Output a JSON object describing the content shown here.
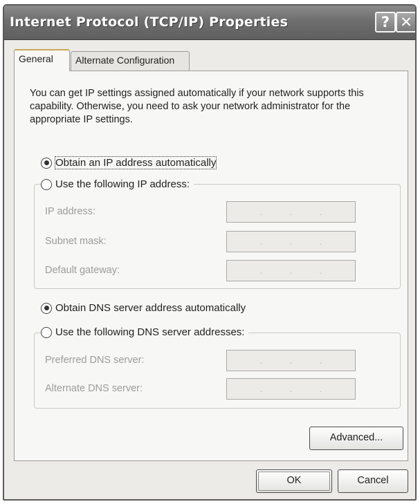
{
  "window": {
    "title": "Internet Protocol (TCP/IP) Properties",
    "help_glyph": "?",
    "close_glyph": "✕"
  },
  "tabs": [
    {
      "label": "General",
      "active": true
    },
    {
      "label": "Alternate Configuration",
      "active": false
    }
  ],
  "intro_text": "You can get IP settings assigned automatically if your network supports this capability. Otherwise, you need to ask your network administrator for the appropriate IP settings.",
  "ip_section": {
    "auto_label": "Obtain an IP address automatically",
    "manual_label": "Use the following IP address:",
    "selected": "auto",
    "fields": [
      {
        "label": "IP address:",
        "value": "",
        "dots": [
          ".",
          ".",
          "."
        ]
      },
      {
        "label": "Subnet mask:",
        "value": "",
        "dots": [
          ".",
          ".",
          "."
        ]
      },
      {
        "label": "Default gateway:",
        "value": "",
        "dots": [
          ".",
          ".",
          "."
        ]
      }
    ]
  },
  "dns_section": {
    "auto_label": "Obtain DNS server address automatically",
    "manual_label": "Use the following DNS server addresses:",
    "selected": "auto",
    "fields": [
      {
        "label": "Preferred DNS server:",
        "value": "",
        "dots": [
          ".",
          ".",
          "."
        ]
      },
      {
        "label": "Alternate DNS server:",
        "value": "",
        "dots": [
          ".",
          ".",
          "."
        ]
      }
    ]
  },
  "buttons": {
    "advanced": "Advanced...",
    "ok": "OK",
    "cancel": "Cancel"
  },
  "colors": {
    "titlebar": "#6e6e6e",
    "dialog_bg": "#ecebe7",
    "disabled_text": "#9c9c9c"
  }
}
